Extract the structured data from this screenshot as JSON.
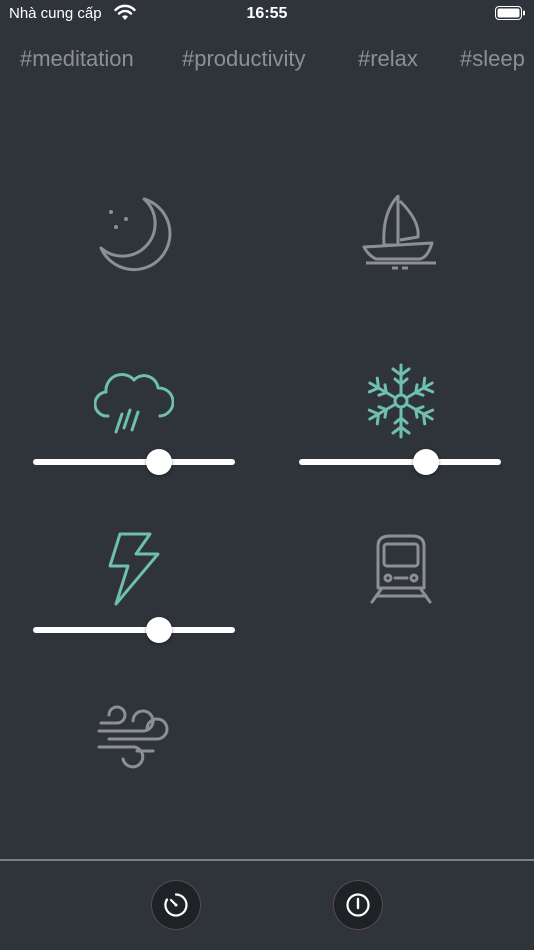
{
  "status_bar": {
    "carrier": "Nhà cung cấp",
    "time": "16:55"
  },
  "tags": [
    "#meditation",
    "#productivity",
    "#relax",
    "#sleep"
  ],
  "sounds": [
    {
      "icon": "moon-stars-icon",
      "active": false
    },
    {
      "icon": "sailboat-icon",
      "active": false
    },
    {
      "icon": "rain-cloud-icon",
      "active": true,
      "volume": 0.63
    },
    {
      "icon": "snowflake-icon",
      "active": true,
      "volume": 0.63
    },
    {
      "icon": "lightning-icon",
      "active": true,
      "volume": 0.63
    },
    {
      "icon": "train-icon",
      "active": false
    },
    {
      "icon": "wind-icon",
      "active": false
    }
  ],
  "colors": {
    "background": "#2f333a",
    "active_icon": "#6fbfae",
    "inactive_icon": "#8c9096",
    "slider": "#ffffff"
  },
  "bottom_bar": {
    "buttons": [
      {
        "icon": "timer-icon"
      },
      {
        "icon": "power-icon"
      }
    ]
  }
}
